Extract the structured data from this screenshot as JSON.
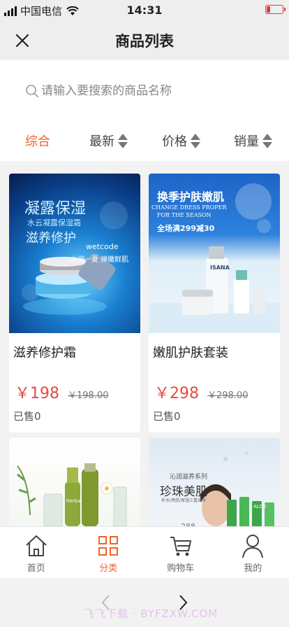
{
  "status_bar": {
    "carrier": "中国电信",
    "time": "14:31"
  },
  "nav": {
    "title": "商品列表",
    "close_icon": "close-icon"
  },
  "search": {
    "placeholder": "请输入要搜索的商品名称",
    "value": ""
  },
  "sort": {
    "tabs": [
      {
        "label": "综合",
        "active": true
      },
      {
        "label": "最新"
      },
      {
        "label": "价格"
      },
      {
        "label": "销量"
      }
    ]
  },
  "products": [
    {
      "name": "滋养修护霜",
      "price": "￥198",
      "old_price": "￥198.00",
      "sold": "已售0",
      "image_text": {
        "headline": "凝露保湿",
        "sub1": "水云凝露保湿霜",
        "sub2": "滋养修护",
        "brand": "wetcode",
        "tag1": "水润一夏 弹嫩鲜肌"
      }
    },
    {
      "name": "嫩肌护肤套装",
      "price": "￥298",
      "old_price": "￥298.00",
      "sold": "已售0",
      "image_text": {
        "headline": "换季护肤嫩肌",
        "en1": "CHANGE DRESS PROPER",
        "en2": "FOR THE SEASON",
        "promo": "全场满299减30",
        "brand": "ISANA"
      }
    },
    {
      "name": "",
      "price": "",
      "old_price": "",
      "sold": "",
      "image_text": {
        "brand": "herbal"
      }
    },
    {
      "name": "",
      "price": "",
      "old_price": "",
      "sold": "",
      "image_text": {
        "series": "沁润滋养系列",
        "headline": "珍珠美肌",
        "sub": "补水/亮肤/保湿三重滋养",
        "price": "288",
        "brand": "ALOE"
      }
    }
  ],
  "tab_bar": {
    "items": [
      {
        "label": "首页",
        "icon": "home-icon"
      },
      {
        "label": "分类",
        "icon": "category-icon",
        "active": true
      },
      {
        "label": "购物车",
        "icon": "cart-icon"
      },
      {
        "label": "我的",
        "icon": "user-icon"
      }
    ]
  },
  "browser": {
    "watermark": "飞飞下载 · BYFZXW.COM"
  },
  "colors": {
    "accent": "#f0622d",
    "price": "#e84a3f",
    "battery": "#e03a3a"
  }
}
